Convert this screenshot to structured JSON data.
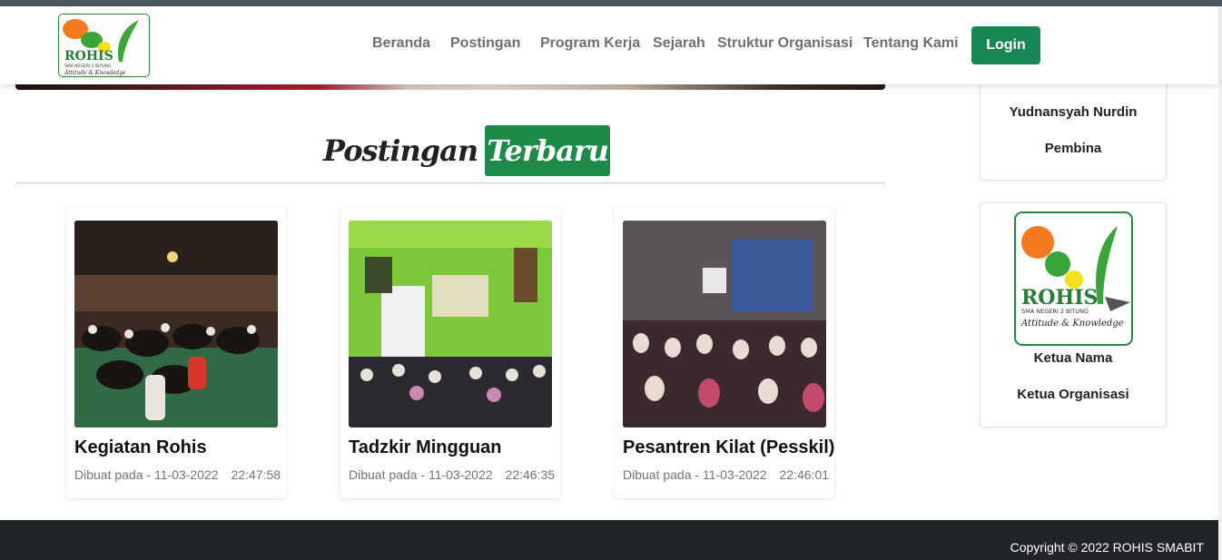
{
  "nav": {
    "links": [
      "Beranda",
      "Postingan",
      "Program Kerja",
      "Sejarah",
      "Struktur Organisasi",
      "Tentang Kami"
    ],
    "login_label": "Login"
  },
  "logo": {
    "brand": "ROHIS",
    "school": "SMA NEGERI 2 BITUNG",
    "tagline": "Attitude & Knowledge"
  },
  "section": {
    "title_word": "Postingan",
    "title_badge": "Terbaru"
  },
  "posts": [
    {
      "title": "Kegiatan Rohis",
      "meta": "Dibuat pada - 11-03-2022",
      "time": "22:47:58"
    },
    {
      "title": "Tadzkir Mingguan",
      "meta": "Dibuat pada - 11-03-2022",
      "time": "22:46:35"
    },
    {
      "title": "Pesantren Kilat (Pesskil)",
      "meta": "Dibuat pada - 11-03-2022",
      "time": "22:46:01"
    }
  ],
  "people": [
    {
      "name": "Yudnansyah Nurdin",
      "role": "Pembina"
    },
    {
      "name": "Ketua Nama",
      "role": "Ketua Organisasi"
    }
  ],
  "footer": {
    "copyright": "Copyright © 2022 ROHIS SMABIT"
  },
  "colors": {
    "primary": "#198754",
    "footer": "#212529",
    "topstrip": "#4a565f"
  }
}
